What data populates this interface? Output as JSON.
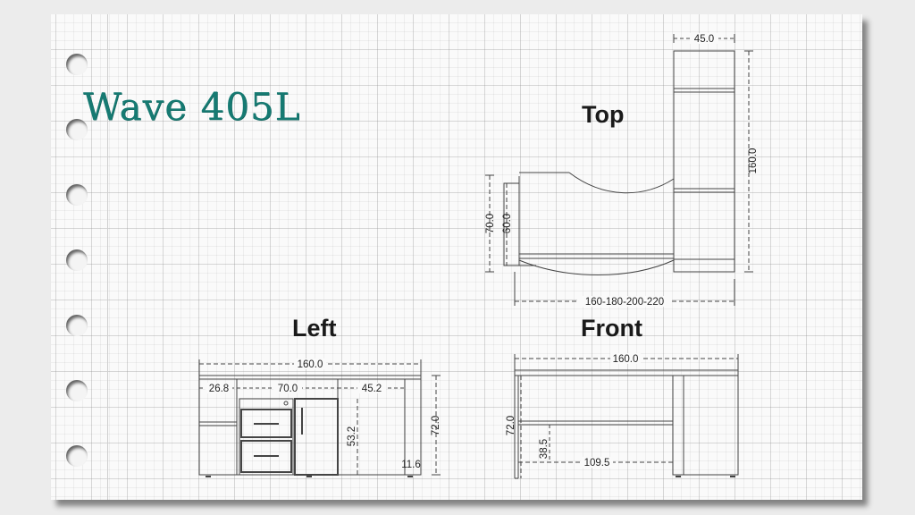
{
  "title": "Wave 405L",
  "views": {
    "top": "Top",
    "left": "Left",
    "front": "Front"
  },
  "dimensions": {
    "top": {
      "width": "45.0",
      "depth_long": "160.0",
      "depth_total": "70.0",
      "depth_inner": "60.0",
      "lengths": "160-180-200-220"
    },
    "left": {
      "overall": "160.0",
      "seg1": "26.8",
      "seg2": "70.0",
      "seg3": "45.2",
      "cabinet_height": "53.2",
      "height": "72.0",
      "leg": "11.6"
    },
    "front": {
      "overall": "160.0",
      "height": "72.0",
      "rail_height": "38.5",
      "rail_length": "109.5"
    }
  },
  "colors": {
    "title": "#167a72",
    "line": "#444444"
  }
}
